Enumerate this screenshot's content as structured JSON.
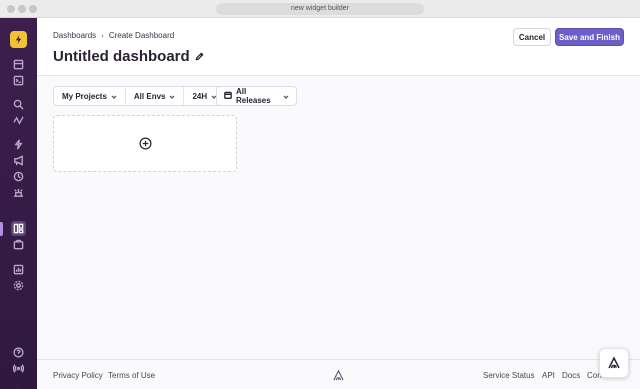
{
  "window": {
    "url": "new widget builder"
  },
  "breadcrumb": {
    "items": [
      "Dashboards",
      "Create Dashboard"
    ],
    "separator": "›"
  },
  "page": {
    "title": "Untitled dashboard"
  },
  "actions": {
    "cancel_label": "Cancel",
    "save_label": "Save and Finish"
  },
  "filters": {
    "projects": "My Projects",
    "environments": "All Envs",
    "period": "24H",
    "releases": "All Releases"
  },
  "footer": {
    "left_links": [
      "Privacy Policy",
      "Terms of Use"
    ],
    "right_links": [
      "Service Status",
      "API",
      "Docs",
      "Con"
    ]
  },
  "sidebar": {
    "icons": [
      "issues-icon",
      "projects-icon",
      "search-icon",
      "performance-icon",
      "releases-icon",
      "alerts-icon",
      "history-icon",
      "crons-icon",
      "dashboards-icon",
      "stats-icon",
      "monitor-icon",
      "settings-icon",
      "help-icon",
      "broadcast-icon",
      "expand-icon"
    ],
    "active": "dashboards-icon"
  },
  "colors": {
    "sidebar": "#3c1f4d",
    "primary": "#6c5fc7",
    "logo": "#f1c233"
  }
}
